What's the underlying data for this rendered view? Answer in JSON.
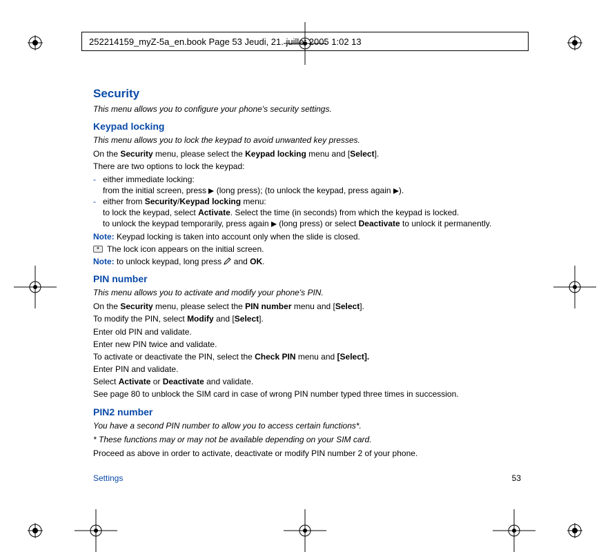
{
  "header": {
    "text": "252214159_myZ-5a_en.book  Page 53  Jeudi, 21. juillet 2005  1:02 13"
  },
  "title": "Security",
  "intro": "This menu allows you to configure your phone's security settings.",
  "sections": {
    "keypad": {
      "heading": "Keypad locking",
      "intro": "This menu allows you to lock the keypad to avoid unwanted key presses.",
      "line1_a": "On the ",
      "line1_b": "Security",
      "line1_c": " menu, please select the ",
      "line1_d": "Keypad locking",
      "line1_e": " menu and [",
      "line1_f": "Select",
      "line1_g": "].",
      "options_lead": "There are two options to lock the keypad:",
      "opt1_a": "either immediate locking:",
      "opt1_b_a": "from the initial screen, press ",
      "opt1_b_b": " (long press); (to unlock the keypad, press again ",
      "opt1_b_c": ").",
      "opt2_a_a": "either from ",
      "opt2_a_b": "Security",
      "opt2_a_c": "/",
      "opt2_a_d": "Keypad locking",
      "opt2_a_e": " menu:",
      "opt2_b_a": "to lock the keypad, select ",
      "opt2_b_b": "Activate",
      "opt2_b_c": ". Select the time (in seconds) from which the keypad is locked.",
      "opt2_c_a": "to unlock the keypad temporarily, press again ",
      "opt2_c_b": " (long press) or select ",
      "opt2_c_c": "Deactivate",
      "opt2_c_d": " to unlock it permanently.",
      "note1_label": "Note:",
      "note1_text": " Keypad locking is taken into account only when the slide is closed.",
      "lock_text": " The lock icon appears on the initial screen.",
      "note2_label": "Note:",
      "note2_a": " to unlock keypad, long press ",
      "note2_b": " and ",
      "note2_c": "OK",
      "note2_d": "."
    },
    "pin": {
      "heading": "PIN number",
      "intro": "This menu allows you to activate and modify your phone's PIN.",
      "l1_a": "On the ",
      "l1_b": "Security",
      "l1_c": " menu, please select the ",
      "l1_d": "PIN number",
      "l1_e": " menu and [",
      "l1_f": "Select",
      "l1_g": "].",
      "l2_a": "To modify the PIN, select ",
      "l2_b": "Modify",
      "l2_c": " and [",
      "l2_d": "Select",
      "l2_e": "].",
      "l3": "Enter old PIN and validate.",
      "l4": "Enter new PIN twice and validate.",
      "l5_a": "To activate or deactivate the PIN, select the ",
      "l5_b": "Check PIN",
      "l5_c": " menu and ",
      "l5_d": "[Select].",
      "l6": "Enter PIN and validate.",
      "l7_a": "Select ",
      "l7_b": "Activate",
      "l7_c": " or ",
      "l7_d": "Deactivate",
      "l7_e": " and validate.",
      "l8": "See page 80 to unblock the SIM card in case of wrong PIN number typed three times in succession."
    },
    "pin2": {
      "heading": "PIN2 number",
      "intro": "You have a second PIN number to allow you to access certain functions*.",
      "note": "* These functions may or may not be available depending on your SIM card.",
      "l1": "Proceed as above in order to activate, deactivate or modify PIN number 2 of your phone."
    }
  },
  "footer": {
    "section": "Settings",
    "page": "53"
  }
}
